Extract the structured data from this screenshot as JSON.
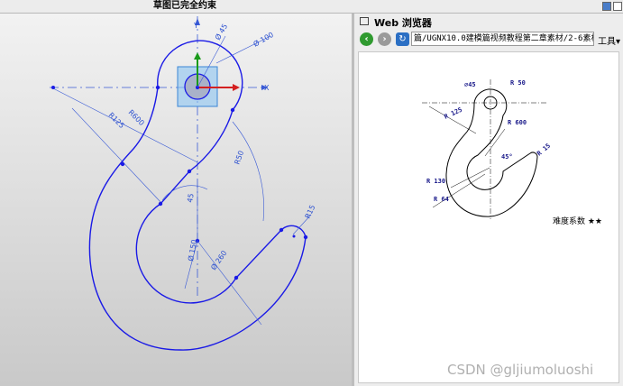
{
  "status": {
    "sketch_status": "草图已完全约束"
  },
  "sketch": {
    "axis_x_label": "X",
    "axis_y_label": "Y",
    "dimensions": {
      "dia45": "Ø 45",
      "dia100": "Ø 100",
      "r600": "R600",
      "r125": "R125",
      "r50": "R50",
      "angle45": "45",
      "dia150": "Ø 150",
      "dia260": "Ø 260",
      "r15": "R15"
    }
  },
  "browser": {
    "title": "Web 浏览器",
    "address": "篇/UGNX10.0建模篇视频教程第二章素材/2-6素材/7.jpg",
    "tools_label": "工具",
    "drawing": {
      "d45": "∅45",
      "r50": "R 50",
      "r125": "R 125",
      "r600": "R 600",
      "r15": "R 15",
      "angle45": "45°",
      "r130": "R 130",
      "r64": "R 64"
    },
    "difficulty": "难度系数 ★★"
  },
  "watermark": "CSDN @gljiumoluoshi",
  "colors": {
    "sketch_line": "#1a1ae6",
    "dimension": "#3a5bd6",
    "datum_box": "#56a0e8"
  }
}
